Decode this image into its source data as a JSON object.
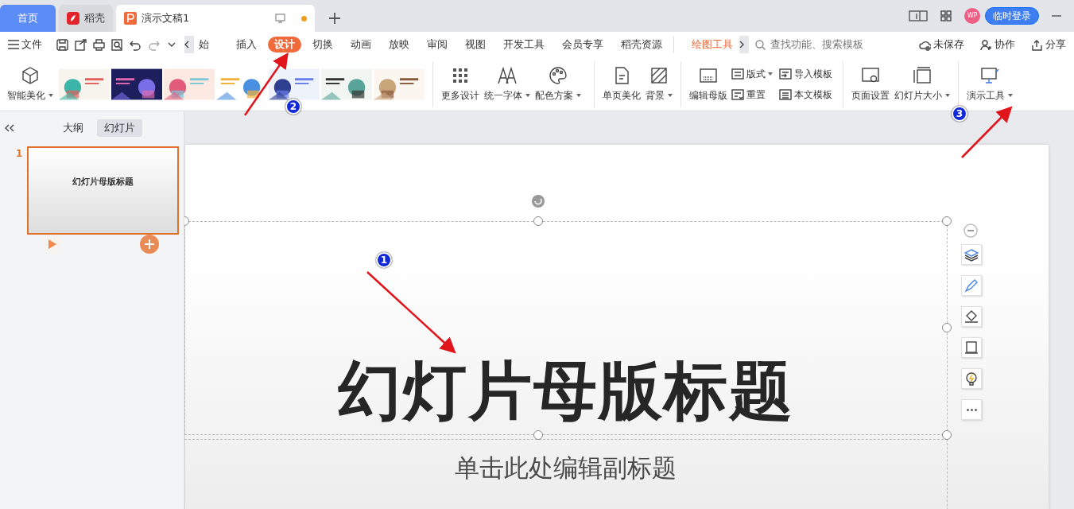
{
  "tab_bar": {
    "tabs": [
      {
        "label": "首页",
        "kind": "home",
        "selected": false
      },
      {
        "label": "稻壳",
        "kind": "app",
        "selected": false
      },
      {
        "label": "演示文稿1",
        "kind": "doc",
        "selected": true,
        "unsaved": true
      }
    ],
    "avatar": "WP",
    "login_button": "临时登录"
  },
  "menu_bar": {
    "file_menu": "文件",
    "ribbon_tabs": [
      {
        "label": "始",
        "selected": false
      },
      {
        "label": "插入",
        "selected": false
      },
      {
        "label": "设计",
        "selected": true
      },
      {
        "label": "切换",
        "selected": false
      },
      {
        "label": "动画",
        "selected": false
      },
      {
        "label": "放映",
        "selected": false
      },
      {
        "label": "审阅",
        "selected": false
      },
      {
        "label": "视图",
        "selected": false
      },
      {
        "label": "开发工具",
        "selected": false
      },
      {
        "label": "会员专享",
        "selected": false
      },
      {
        "label": "稻壳资源",
        "selected": false
      }
    ],
    "context_tab": "绘图工具",
    "search": {
      "placeholder": "查找功能、搜索模板"
    },
    "actions": [
      "未保存",
      "协作",
      "分享"
    ]
  },
  "ribbon": {
    "smart_beautify": {
      "label": "智能美化",
      "dropdown": true
    },
    "templates": [
      {
        "kind": "picture"
      },
      {
        "kind": "picture"
      },
      {
        "kind": "picture"
      },
      {
        "kind": "picture"
      },
      {
        "kind": "picture"
      },
      {
        "kind": "picture"
      },
      {
        "kind": "picture"
      }
    ],
    "groups": [
      [
        {
          "label": "更多设计",
          "kind": "large",
          "dropdown": false
        },
        {
          "label": "统一字体",
          "kind": "large",
          "dropdown": true
        },
        {
          "label": "配色方案",
          "kind": "large",
          "dropdown": true
        }
      ],
      [
        {
          "label": "单页美化",
          "kind": "large",
          "dropdown": false
        },
        {
          "label": "背景",
          "kind": "large",
          "dropdown": true
        }
      ],
      [
        {
          "label": "编辑母版",
          "kind": "large",
          "dropdown": false
        },
        {
          "label": "版式",
          "kind": "small",
          "dropdown": true
        },
        {
          "label": "重置",
          "kind": "small",
          "dropdown": false
        },
        {
          "label": "导入模板",
          "kind": "small",
          "dropdown": false
        },
        {
          "label": "本文模板",
          "kind": "small",
          "dropdown": false
        }
      ],
      [
        {
          "label": "页面设置",
          "kind": "large",
          "dropdown": false
        },
        {
          "label": "幻灯片大小",
          "kind": "large",
          "dropdown": true
        }
      ],
      [
        {
          "label": "演示工具",
          "kind": "large",
          "dropdown": true
        }
      ]
    ]
  },
  "sidebar": {
    "view_tabs": [
      {
        "label": "大纲",
        "selected": false
      },
      {
        "label": "幻灯片",
        "selected": true
      }
    ],
    "slides": [
      {
        "number": "1",
        "title": "幻灯片母版标题",
        "selected": true
      }
    ]
  },
  "slide": {
    "title": "幻灯片母版标题",
    "subtitle": "单击此处编辑副标题"
  },
  "annotations": [
    {
      "number": "1"
    },
    {
      "number": "2"
    },
    {
      "number": "3"
    }
  ]
}
